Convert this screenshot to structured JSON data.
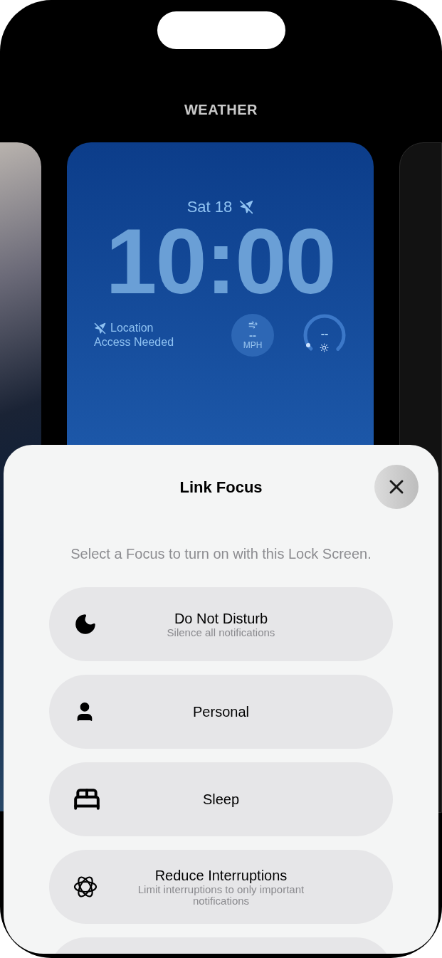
{
  "carousel": {
    "title": "WEATHER"
  },
  "lock_screen": {
    "date": "Sat 18",
    "time": "10:00",
    "location_lines": [
      "Location",
      "Access Needed"
    ],
    "wind": {
      "value": "--",
      "unit": "MPH"
    },
    "uv": {
      "value": "--",
      "level": 0.05
    }
  },
  "sheet": {
    "title": "Link Focus",
    "subtitle": "Select a Focus to turn on with this Lock Screen.",
    "options": [
      {
        "kind": "moon",
        "title": "Do Not Disturb",
        "detail": "Silence all notifications"
      },
      {
        "kind": "person",
        "title": "Personal"
      },
      {
        "kind": "bed",
        "title": "Sleep"
      },
      {
        "kind": "orbit",
        "title": "Reduce Interruptions",
        "detail": "Limit interruptions to only important notifications"
      },
      {
        "kind": "empty"
      }
    ]
  }
}
